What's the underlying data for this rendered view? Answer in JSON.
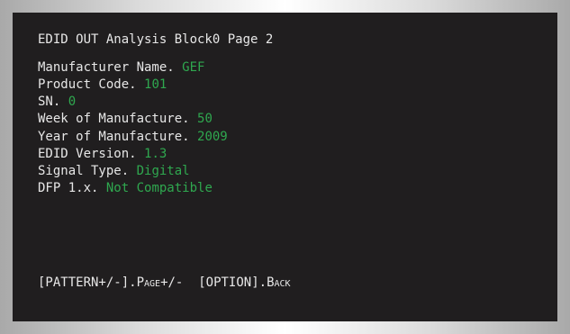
{
  "screen": {
    "title": "EDID OUT Analysis Block0 Page 2",
    "fields": [
      {
        "label": "Manufacturer Name.",
        "value": "GEF"
      },
      {
        "label": "Product Code.",
        "value": "101"
      },
      {
        "label": "SN.",
        "value": "0"
      },
      {
        "label": "Week of Manufacture.",
        "value": "50"
      },
      {
        "label": "Year of Manufacture.",
        "value": "2009"
      },
      {
        "label": "EDID Version.",
        "value": "1.3"
      },
      {
        "label": "Signal Type.",
        "value": "Digital"
      },
      {
        "label": "DFP 1.x.",
        "value": "Not Compatible"
      }
    ],
    "footer": {
      "pattern_key": "[PATTERN+/-].",
      "page_label": "Page+/-",
      "option_key": "[OPTION].",
      "back_label": "Back"
    }
  },
  "colors": {
    "background": "#201e1f",
    "text": "#e7e7e7",
    "value": "#2fa84f"
  }
}
